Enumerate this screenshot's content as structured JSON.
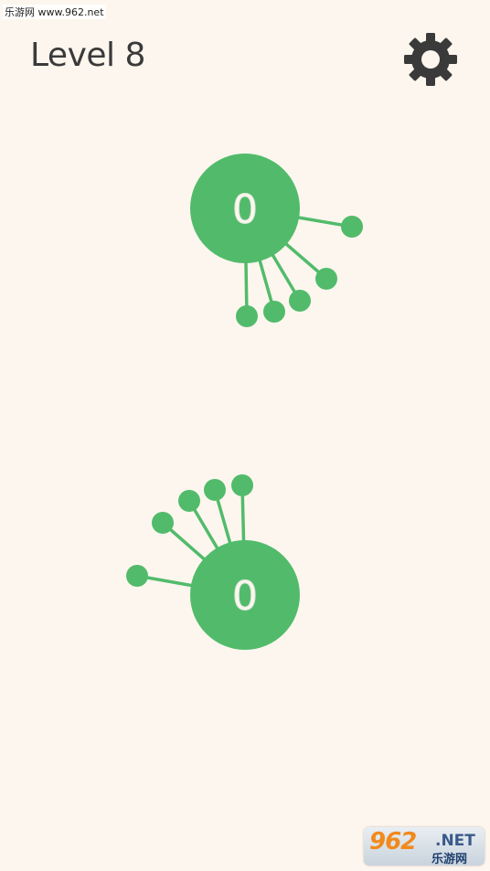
{
  "watermark": {
    "top_text": "乐游网 www.962.net",
    "logo_number": "962",
    "logo_suffix": ".NET",
    "logo_chinese": "乐游网"
  },
  "header": {
    "level_label": "Level 8",
    "settings_icon": "gear-icon"
  },
  "colors": {
    "background": "#fdf6ee",
    "accent_green": "#52bb6b",
    "text_dark": "#3a3a3a"
  },
  "game": {
    "hubs": [
      {
        "id": "top-hub",
        "count": "0",
        "pins": 5
      },
      {
        "id": "bottom-hub",
        "count": "0",
        "pins": 5
      }
    ]
  }
}
